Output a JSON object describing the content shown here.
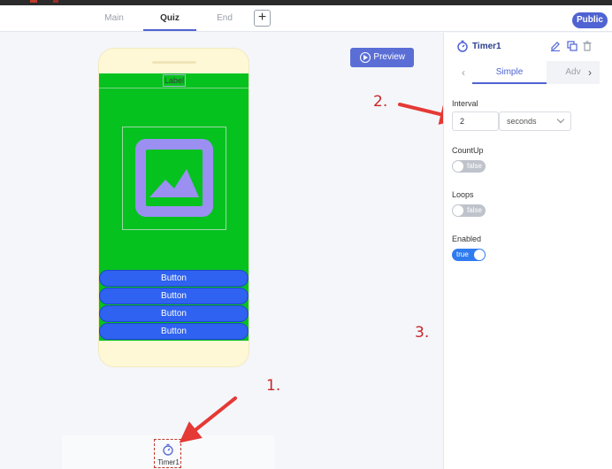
{
  "tabs": [
    {
      "label": "Main"
    },
    {
      "label": "Quiz"
    },
    {
      "label": "End"
    }
  ],
  "tab_add_label": "+",
  "public_label": "Public",
  "preview_label": "Preview",
  "phone": {
    "label_text": "Label",
    "buttons": [
      "Button",
      "Button",
      "Button",
      "Button"
    ]
  },
  "nonvisible": {
    "timer_label": "Timer1"
  },
  "annotations": {
    "one": "1.",
    "two": "2.",
    "three": "3."
  },
  "panel": {
    "title": "Timer1",
    "tab_simple": "Simple",
    "tab_advanced": "Adv",
    "interval_label": "Interval",
    "interval_value": "2",
    "interval_unit": "seconds",
    "countup_label": "CountUp",
    "countup_value": "false",
    "loops_label": "Loops",
    "loops_value": "false",
    "enabled_label": "Enabled",
    "enabled_value": "true"
  },
  "colors": {
    "accent": "#4f63d2",
    "screen_bg": "#05c21f",
    "button_bg": "#2f62f0",
    "phone_bg": "#fff8d6",
    "image_icon": "#9b8ff2",
    "annotation": "#c62828",
    "toggle_on": "#2f7bef",
    "toggle_off": "#bfc3cb"
  },
  "icons": {
    "timer": "stopwatch-icon",
    "edit": "pencil-icon",
    "copy": "copy-icon",
    "delete": "trash-icon",
    "image": "image-placeholder-icon",
    "preview": "play-circle-icon"
  }
}
